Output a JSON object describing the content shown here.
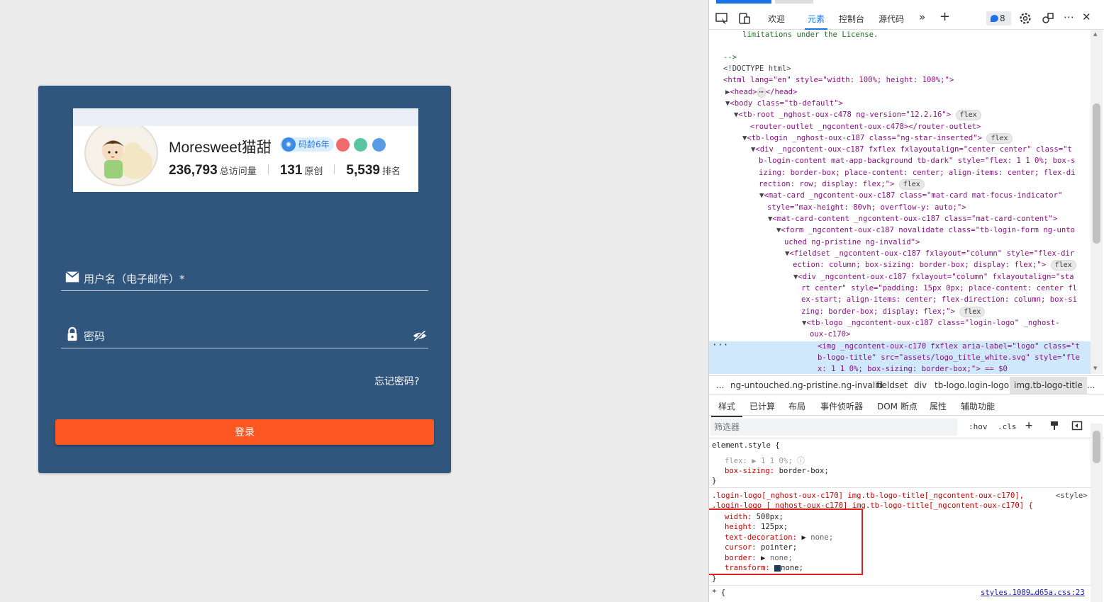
{
  "login": {
    "logo": {
      "name": "Moresweet猫甜",
      "badge": "码龄6年",
      "stats": [
        {
          "num": "236,793",
          "label": "总访问量"
        },
        {
          "num": "131",
          "label": "原创"
        },
        {
          "num": "5,539",
          "label": "排名"
        }
      ]
    },
    "username_label": "用户名（电子邮件）*",
    "password_label": "密码",
    "forgot": "忘记密码?",
    "login_button": "登录",
    "colors": {
      "card": "#31567e",
      "button": "#ff5722"
    }
  },
  "devtools": {
    "tabs": [
      "欢迎",
      "元素",
      "控制台",
      "源代码"
    ],
    "active_tab": "元素",
    "message_count": "8",
    "dom_lines": [
      "limitations under the License.",
      "-->",
      "<!DOCTYPE html>",
      "<html lang=\"en\" style=\"width: 100%; height: 100%;\">",
      "<head>",
      "</head>",
      "<body class=\"tb-default\">",
      "<tb-root _nghost-oux-c478 ng-version=\"12.2.16\">",
      "<router-outlet _ngcontent-oux-c478></router-outlet>",
      "<tb-login _nghost-oux-c187 class=\"ng-star-inserted\">",
      "<div _ngcontent-oux-c187 fxflex fxlayoutalign=\"center center\" class=\"t",
      "b-login-content mat-app-background tb-dark\" style=\"flex: 1 1 0%; box-s",
      "izing: border-box; place-content: center; align-items: center; flex-di",
      "rection: row; display: flex;\">",
      "<mat-card _ngcontent-oux-c187 class=\"mat-card mat-focus-indicator\"",
      "style=\"max-height: 80vh; overflow-y: auto;\">",
      "<mat-card-content _ngcontent-oux-c187 class=\"mat-card-content\">",
      "<form _ngcontent-oux-c187 novalidate class=\"tb-login-form ng-unto",
      "uched ng-pristine ng-invalid\">",
      "<fieldset _ngcontent-oux-c187 fxlayout=\"column\" style=\"flex-dir",
      "ection: column; box-sizing: border-box; display: flex;\">",
      "<div _ngcontent-oux-c187 fxlayout=\"column\" fxlayoutalign=\"sta",
      "rt center\" style=\"padding: 15px 0px; place-content: center fl",
      "ex-start; align-items: center; flex-direction: column; box-si",
      "zing: border-box; display: flex;\">",
      "<tb-logo _ngcontent-oux-c187 class=\"login-logo\" _nghost-",
      "oux-c170>",
      "<img _ngcontent-oux-c170 fxflex aria-label=\"logo\" class=\"t",
      "b-logo-title\" src=\"assets/logo_title_white.svg\" style=\"fle",
      "x: 1 1 0%; box-sizing: border-box;\"> == $0"
    ],
    "flex_badge": "flex",
    "breadcrumbs": [
      "...",
      "ng-untouched.ng-pristine.ng-invalid",
      "fieldset",
      "div",
      "tb-logo.login-logo",
      "img.tb-logo-title",
      "..."
    ],
    "style_tabs": [
      "样式",
      "已计算",
      "布局",
      "事件侦听器",
      "DOM 断点",
      "属性",
      "辅助功能"
    ],
    "filter_placeholder": "筛选器",
    "filter_buttons": [
      ":hov",
      ".cls"
    ],
    "styles": {
      "element_style": "element.style {",
      "flex_prop": "flex:",
      "flex_val": "1 1 0%;",
      "box_sizing_prop": "box-sizing:",
      "box_sizing_val": "border-box;",
      "close": "}",
      "selector1": ".login-logo[_nghost-oux-c170] img.tb-logo-title[_ngcontent-oux-c170],",
      "selector2": ".login-logo [_nghost-oux-c170] img.tb-logo-title[_ngcontent-oux-c170] {",
      "source_style": "<style>",
      "props": [
        {
          "name": "width:",
          "value": "500px;"
        },
        {
          "name": "height:",
          "value": "125px;"
        },
        {
          "name": "text-decoration:",
          "value": "none;"
        },
        {
          "name": "cursor:",
          "value": "pointer;"
        },
        {
          "name": "border:",
          "value": "none;"
        },
        {
          "name": "transform:",
          "value": "none;"
        }
      ],
      "universal": "* {",
      "source_file": "styles.1089…d65a.css:23"
    }
  }
}
